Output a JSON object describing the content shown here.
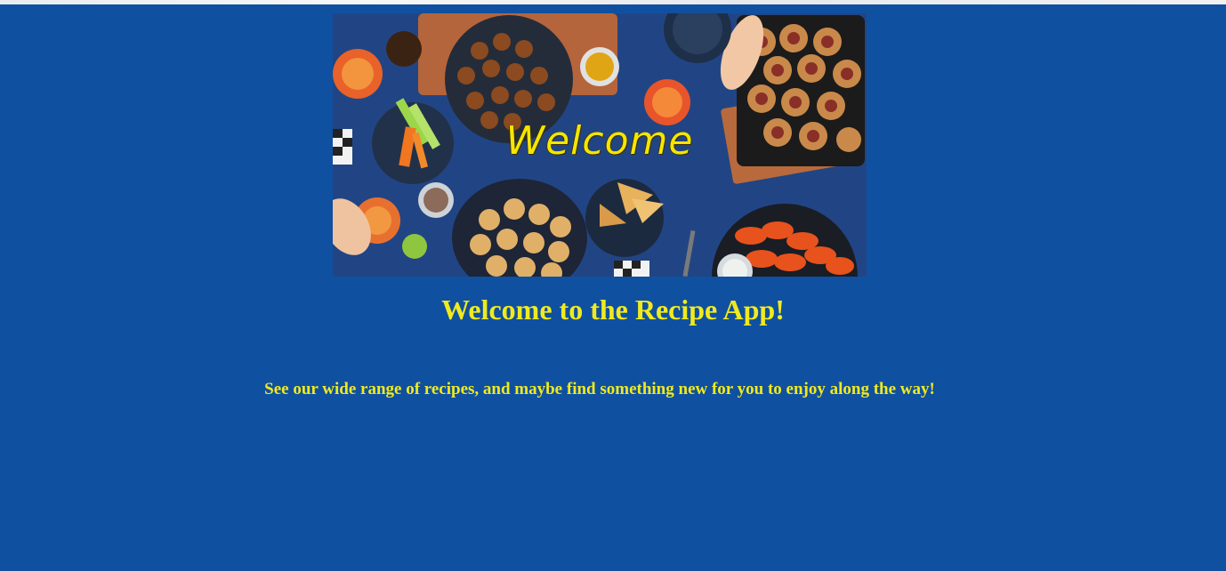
{
  "hero": {
    "overlay_text": "Welcome",
    "image_icon": "food-spread-image"
  },
  "page": {
    "title": "Welcome to the Recipe App!",
    "tagline": "See our wide range of recipes, and maybe find something new for you to enjoy along the way!"
  },
  "colors": {
    "background": "#1050a0",
    "heading_text": "#f0ea1e"
  }
}
